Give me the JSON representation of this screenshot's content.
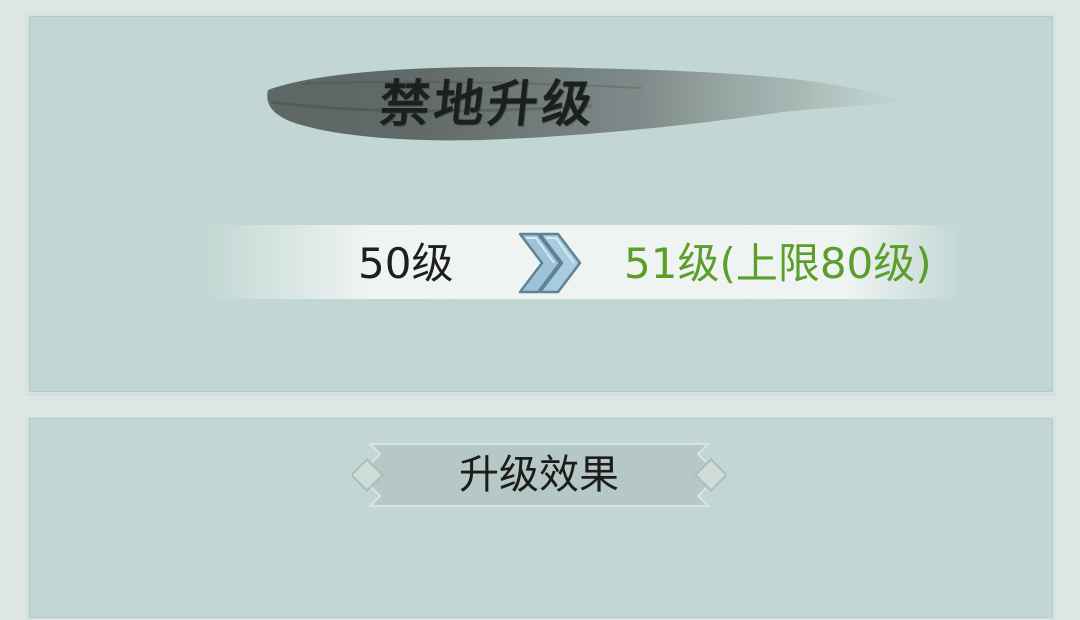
{
  "upgrade_panel": {
    "title": "禁地升级",
    "current_level": "50级",
    "next_level": "51级(上限80级)",
    "arrow_icon": "double-chevron-right-icon",
    "next_level_color": "#5b9e2a"
  },
  "effects_panel": {
    "title": "升级效果"
  }
}
